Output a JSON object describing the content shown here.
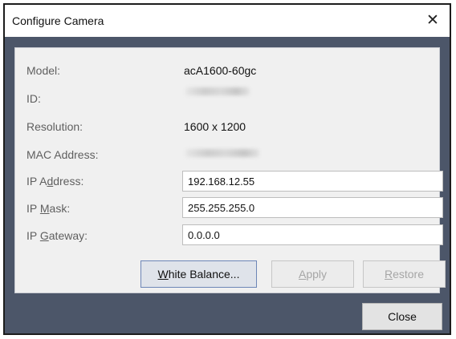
{
  "window": {
    "title": "Configure Camera",
    "close_glyph": "✕"
  },
  "info": {
    "model_label": "Model:",
    "model_value": "acA1600-60gc",
    "id_label": "ID:",
    "resolution_label": "Resolution:",
    "resolution_value": "1600 x 1200",
    "mac_label": "MAC Address:"
  },
  "network": {
    "ip_address": {
      "label_pre": "IP A",
      "label_key": "d",
      "label_post": "dress:",
      "value": "192.168.12.55"
    },
    "ip_mask": {
      "label_pre": "IP ",
      "label_key": "M",
      "label_post": "ask:",
      "value": "255.255.255.0"
    },
    "ip_gateway": {
      "label_pre": "IP ",
      "label_key": "G",
      "label_post": "ateway:",
      "value": "0.0.0.0"
    }
  },
  "buttons": {
    "white_balance": {
      "key": "W",
      "rest": "hite Balance..."
    },
    "apply": {
      "key": "A",
      "rest": "pply"
    },
    "restore": {
      "key": "R",
      "rest": "estore"
    },
    "close": "Close"
  },
  "colors": {
    "client_background": "#4c5669",
    "panel_background": "#f0f0f0",
    "primary_button_border": "#6d86b7",
    "disabled_text": "#a6a6a6"
  },
  "icons": {
    "close": "close-icon"
  }
}
